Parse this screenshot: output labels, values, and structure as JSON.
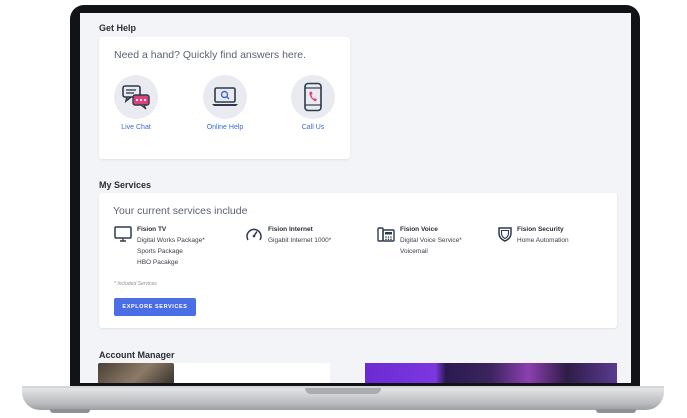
{
  "get_help": {
    "title": "Get Help",
    "prompt": "Need a hand?  Quickly find answers here.",
    "items": [
      {
        "label": "Live Chat",
        "icon": "chat-bubbles-icon"
      },
      {
        "label": "Online Help",
        "icon": "laptop-search-icon"
      },
      {
        "label": "Call Us",
        "icon": "phone-icon"
      }
    ]
  },
  "my_services": {
    "title": "My Services",
    "subtitle": "Your current services include",
    "services": [
      {
        "name": "Fision TV",
        "lines": [
          "Digital Works Package*",
          "Sports Package",
          "HBO Pacakge"
        ],
        "icon": "tv-icon"
      },
      {
        "name": "Fision Internet",
        "lines": [
          "Gigabit Internet 1000*"
        ],
        "icon": "speedometer-icon"
      },
      {
        "name": "Fision Voice",
        "lines": [
          "Digital Voice Service*",
          "Voicemail"
        ],
        "icon": "desk-phone-icon"
      },
      {
        "name": "Fision Security",
        "lines": [
          "Home Automation"
        ],
        "icon": "shield-icon"
      }
    ],
    "note": "* Included Services",
    "explore_label": "EXPLORE SERVICES"
  },
  "account_manager": {
    "title": "Account Manager"
  },
  "colors": {
    "accent": "#4a6ee6",
    "link": "#3a6bd8",
    "icon_stroke": "#2f3a4f",
    "page_bg": "#f3f4f8"
  }
}
